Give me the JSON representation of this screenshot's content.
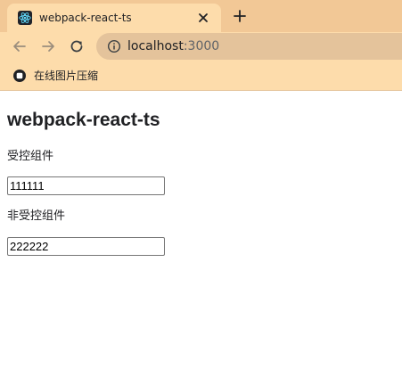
{
  "browser": {
    "tab": {
      "title": "webpack-react-ts"
    },
    "address_bar": {
      "host": "localhost",
      "port": ":3000"
    },
    "bookmarks": [
      {
        "label": "在线图片压缩"
      }
    ]
  },
  "page": {
    "title": "webpack-react-ts",
    "controlled": {
      "label": "受控组件",
      "value": "111111"
    },
    "uncontrolled": {
      "label": "非受控组件",
      "value": "222222"
    }
  },
  "colors": {
    "tabstrip": "#f2c896",
    "active_tab": "#fddcab",
    "omnibox": "#e4c39b",
    "page_background": "#ffffff"
  },
  "icons": {
    "tab_favicon": "react-logo-icon",
    "tab_close": "close-icon",
    "new_tab": "plus-icon",
    "back": "arrow-left-icon",
    "forward": "arrow-right-icon",
    "reload": "reload-icon",
    "site_info": "info-icon",
    "bookmark": "bookmark-favicon-icon"
  }
}
